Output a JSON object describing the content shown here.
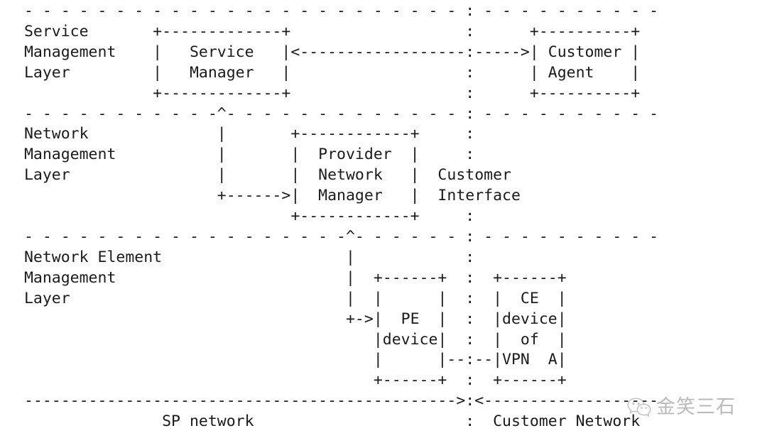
{
  "diagram": {
    "title": "Service Provider / Customer Network Management Layers",
    "type": "ascii-art-diagram",
    "font_color": "#1b1b1b",
    "background": "#ffffff",
    "layers": [
      {
        "name": "Service Management Layer",
        "lines": [
          "Service",
          "Management",
          "Layer"
        ]
      },
      {
        "name": "Network Management Layer",
        "lines": [
          "Network",
          "Management",
          "Layer"
        ]
      },
      {
        "name": "Network Element Management Layer",
        "lines": [
          "Network Element",
          "Management",
          "Layer"
        ]
      }
    ],
    "boxes": [
      {
        "name": "Service Manager",
        "lines": [
          "Service",
          "Manager"
        ],
        "width_dashes": 13
      },
      {
        "name": "Customer Agent",
        "lines": [
          "Customer",
          "Agent"
        ],
        "width_dashes": 10
      },
      {
        "name": "Provider Network Manager",
        "lines": [
          "Provider",
          "Network",
          "Manager"
        ],
        "width_dashes": 12
      },
      {
        "name": "PE device",
        "lines": [
          "PE",
          "device"
        ],
        "width_dashes": 6
      },
      {
        "name": "CE device of VPN A",
        "lines": [
          "CE",
          "device",
          "of",
          "VPN  A"
        ],
        "width_dashes": 6
      }
    ],
    "annotations": [
      "Customer Interface",
      "SP network",
      "Customer Network"
    ],
    "ascii": "- - - - - - - - - - - - - - - - - - - - - - -:- - - - - - - - -\nService       +-------------+                :      +----------+\nManagement    |   Service   |<---------------:----->| Customer |\nLayer         |   Manager   |                :      | Agent    |\n              +-------------+                :      +----------+\n- - - - - - - - -^- - - - - - - - - - - - - -:- - - - - - - - -\nNetwork          |     +------------+        :\nManagement       |     |  Provider  |        :\nLayer            |     |  Network   |  Customer\n                 +---->|  Manager   |  Interface\n                       +------------+        :\n- - - - - - - - - - - - - -^- - - - - - - - -:- - - - - - - - -\nNetwork Element            |                 :\nManagement                 |  +------+   :  +------+\nLayer                      |  |      |   :  |  CE  |\n                           +->|  PE  |   :  |device|\n                              |device|   :  |  of  |\n                              |      |--:--|VPN  A|\n                              +------+   :  +------+\n--------------------------------------------->:<---------------\n              SP network                 :  Customer Network"
  },
  "watermark": {
    "present": true,
    "logo_name": "wechat-logo",
    "text": "金笑三石",
    "color": "#5a5a5a"
  },
  "art_lines": [
    "- - - - - - - - - - - - - - - - - - - - - - - - - - - - -:- - - - - - - - - - - - - - -",
    "Service       +-------------+                             :      +----------+",
    "Management    |   Service   |<---------------------------:----->| Customer |",
    "Layer         |   Manager   |                             :      | Agent    |",
    "              +-------------+                             :      +----------+",
    "- - - - - - - - -^- - - - - - - - - - - - - - - - - - - -:- - - - - - - - - - - - - - -",
    "Network          |     +------------+                     :",
    "Management       |     |  Provider  |                     :",
    "Layer            |     |  Network   |   Customer",
    "                 +---->|  Manager   |   Interface",
    "                       +------------+                     :",
    "- - - - - - - - - - - - - - - -^- - - - - - - - - - - - -:- - - - - - - - - - - - - - -",
    "Network Element                |                          :",
    "Management                     |  +------+    :   +------+",
    "Layer                          |  |      |    :   |  CE  |",
    "                               +->|  PE  |    :   |device|",
    "                                  |device|    :   |  of  |",
    "                                  |      |--:--|VPN  A|",
    "                                  +------+    :   +------+",
    "------------------------------------------------>:<---------------",
    "              SP network                  :   Customer Network"
  ]
}
